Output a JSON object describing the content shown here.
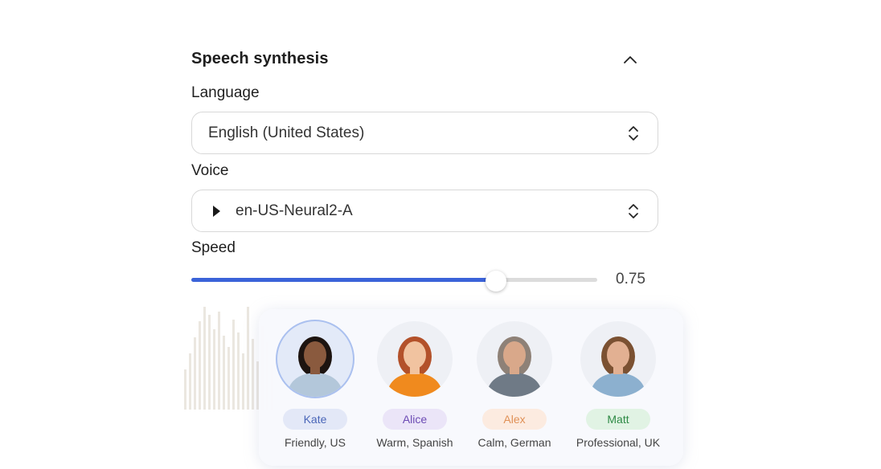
{
  "section": {
    "title": "Speech synthesis",
    "collapse_icon": "chevron-up-icon"
  },
  "language": {
    "label": "Language",
    "value": "English (United States)",
    "icon": "up-down-caret-icon"
  },
  "voice": {
    "label": "Voice",
    "value": "en-US-Neural2-A",
    "play_icon": "play-icon",
    "icon": "up-down-caret-icon"
  },
  "speed": {
    "label": "Speed",
    "value": 0.75,
    "value_text": "0.75",
    "accent": "#3b63d9"
  },
  "personas": [
    {
      "name": "Kate",
      "desc": "Friendly, US",
      "selected": true,
      "badge_bg": "#e3e8f7",
      "badge_fg": "#4a66b8",
      "skin": "#8a5a3e",
      "hair": "#1d1410",
      "shirt": "#b3c7da"
    },
    {
      "name": "Alice",
      "desc": "Warm, Spanish",
      "selected": false,
      "badge_bg": "#ebe5f8",
      "badge_fg": "#6c4bb4",
      "skin": "#f1c3a0",
      "hair": "#b3512a",
      "shirt": "#f08a1e"
    },
    {
      "name": "Alex",
      "desc": "Calm, German",
      "selected": false,
      "badge_bg": "#fcebe0",
      "badge_fg": "#e09157",
      "skin": "#d9a88a",
      "hair": "#8e8177",
      "shirt": "#6f7a86"
    },
    {
      "name": "Matt",
      "desc": "Professional, UK",
      "selected": false,
      "badge_bg": "#e1f3e4",
      "badge_fg": "#2e8a45",
      "skin": "#e2b092",
      "hair": "#7b5132",
      "shirt": "#8cb0cf"
    }
  ]
}
